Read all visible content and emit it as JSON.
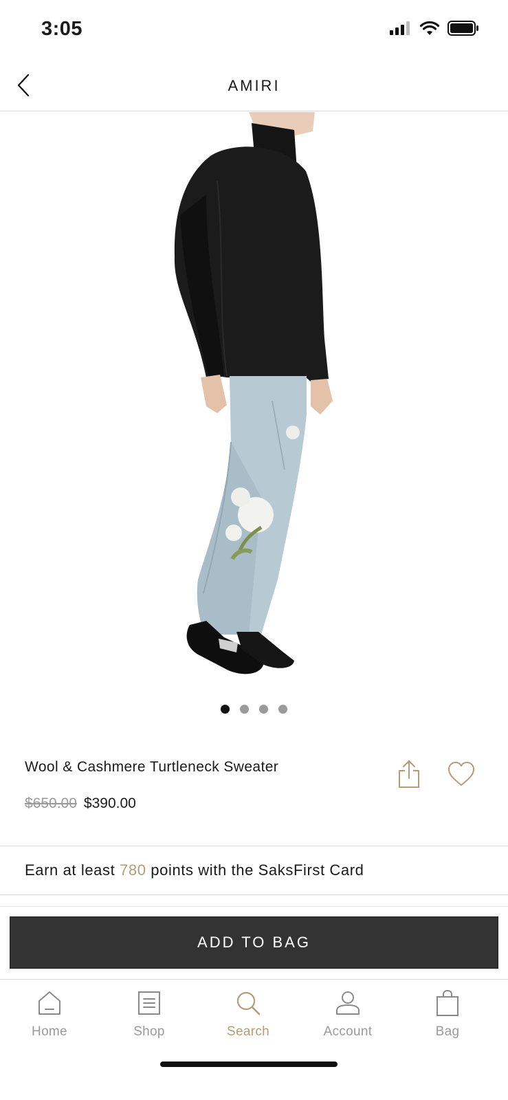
{
  "status_bar": {
    "time": "3:05"
  },
  "header": {
    "brand": "AMIRI"
  },
  "product": {
    "name": "Wool & Cashmere Turtleneck Sweater",
    "price_original": "$650.00",
    "price_sale": "$390.00",
    "image_count": 4,
    "active_image_index": 0
  },
  "points": {
    "prefix": "Earn at least",
    "value": "780",
    "suffix": "points with the SaksFirst Card"
  },
  "cta": {
    "add_to_bag_label": "ADD TO BAG"
  },
  "tab_bar": {
    "items": [
      {
        "label": "Home",
        "icon": "home-icon",
        "active": false
      },
      {
        "label": "Shop",
        "icon": "shop-list-icon",
        "active": false
      },
      {
        "label": "Search",
        "icon": "search-icon",
        "active": true
      },
      {
        "label": "Account",
        "icon": "account-icon",
        "active": false
      },
      {
        "label": "Bag",
        "icon": "bag-icon",
        "active": false
      }
    ]
  },
  "colors": {
    "accent": "#b59b78",
    "button_bg": "#333333",
    "inactive": "#9a9a9a",
    "text": "#1a1a1a"
  }
}
